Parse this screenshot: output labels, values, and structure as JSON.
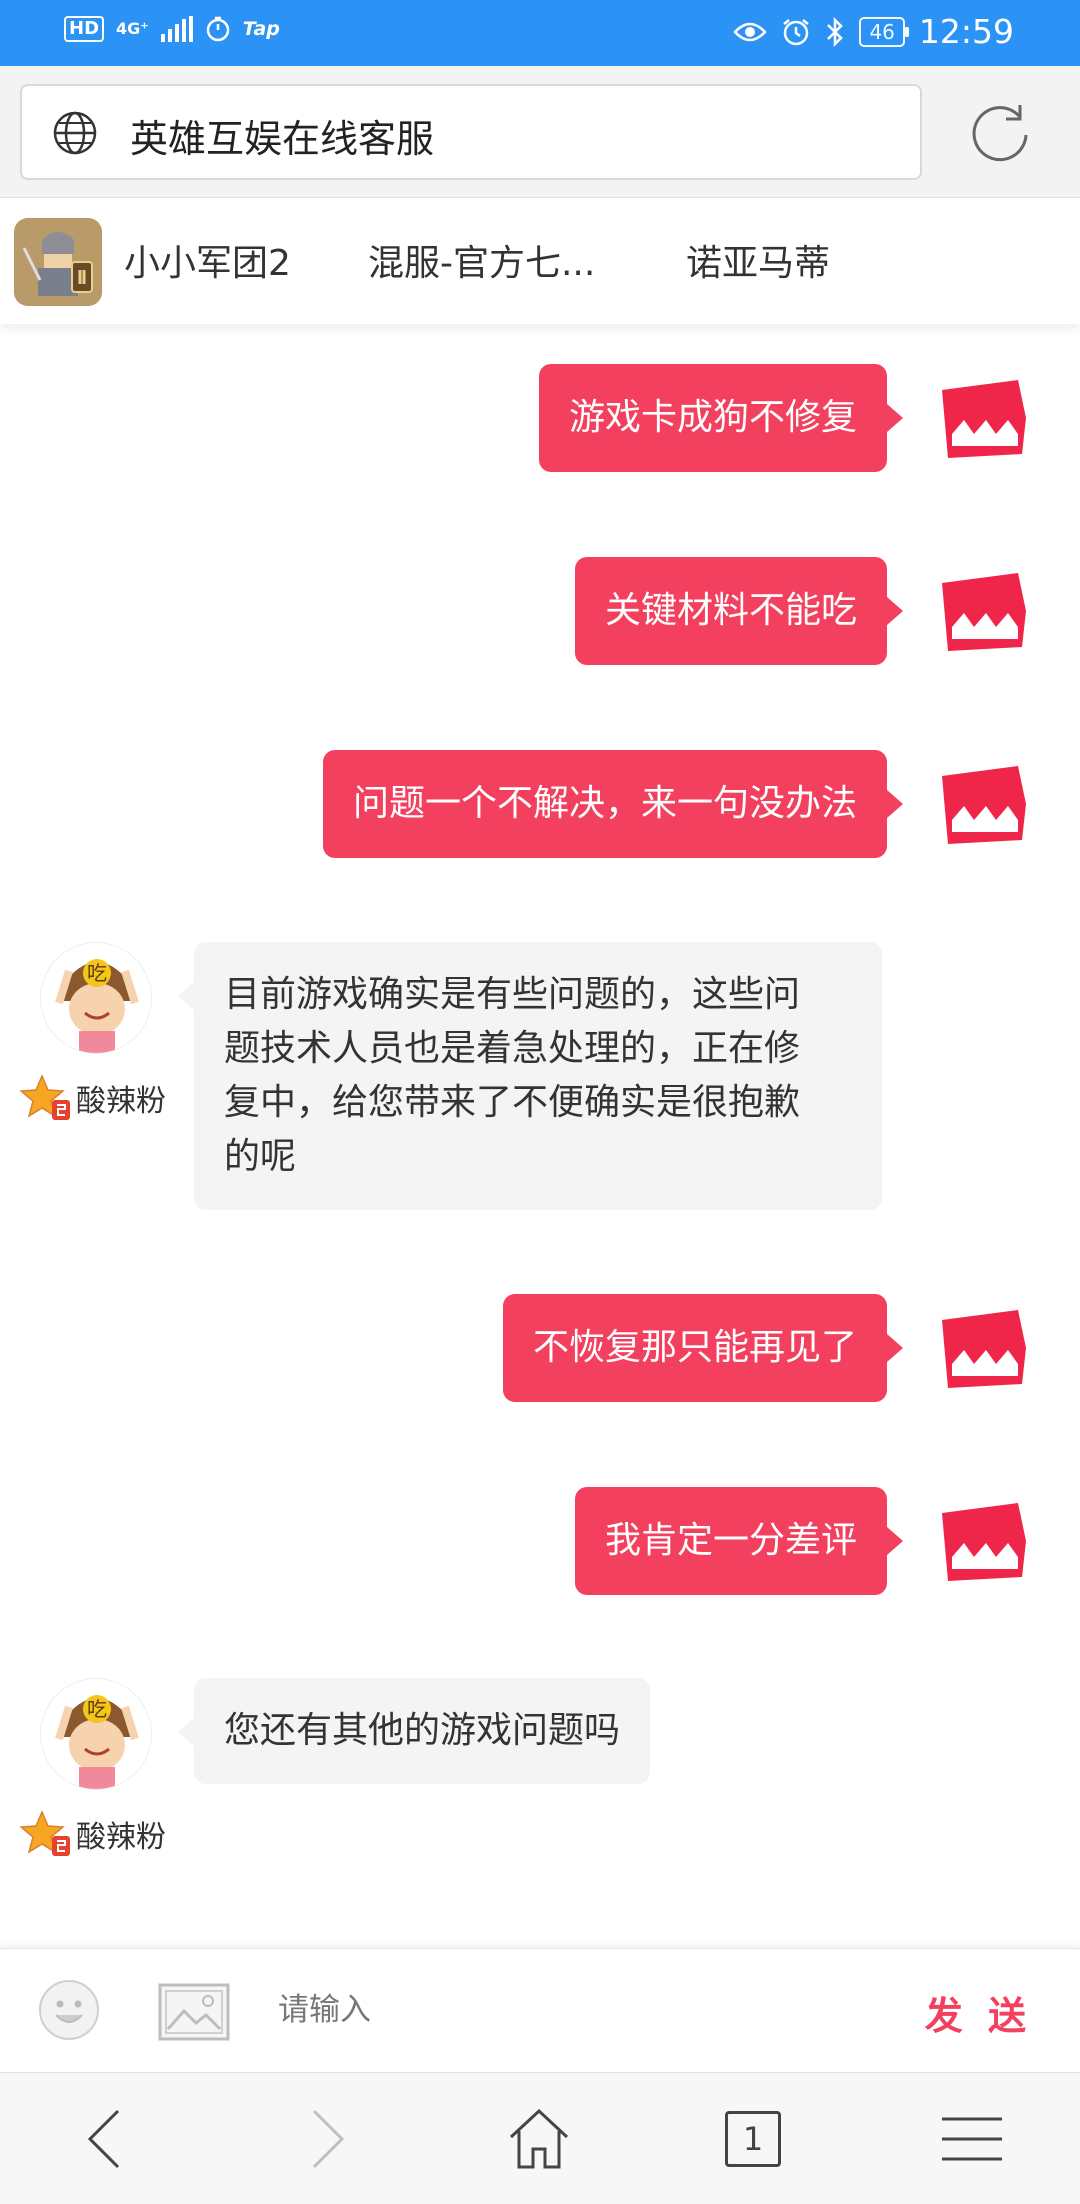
{
  "status_bar": {
    "hd": "HD",
    "network": "4G⁺",
    "app_label": "Tap",
    "battery": "46",
    "time": "12:59",
    "icons": [
      "hd-icon",
      "signal-icon",
      "timer-icon",
      "eye-icon",
      "alarm-icon",
      "bluetooth-icon",
      "battery-icon"
    ]
  },
  "url_bar": {
    "title": "英雄互娱在线客服"
  },
  "tabs": [
    {
      "label": "小小军团2"
    },
    {
      "label": "混服-官方七..."
    },
    {
      "label": "诺亚马蒂"
    }
  ],
  "agent": {
    "name": "酸辣粉",
    "avatar_text": "吃"
  },
  "messages": [
    {
      "side": "out",
      "text": "游戏卡成狗不修复"
    },
    {
      "side": "out",
      "text": "关键材料不能吃"
    },
    {
      "side": "out",
      "text": "问题一个不解决，来一句没办法"
    },
    {
      "side": "in",
      "lines": [
        "目前游戏确实是有些问题的，这些问",
        "题技术人员也是着急处理的，正在修",
        "复中，给您带来了不便确实是很抱歉",
        "的呢"
      ]
    },
    {
      "side": "out",
      "text": "不恢复那只能再见了"
    },
    {
      "side": "out",
      "text": "我肯定一分差评"
    },
    {
      "side": "in",
      "lines": [
        "您还有其他的游戏问题吗"
      ]
    }
  ],
  "input_bar": {
    "placeholder": "请输入",
    "send_label": "发 送"
  },
  "nav": {
    "tab_count": "1"
  },
  "colors": {
    "status_bar": "#2b93f5",
    "accent": "#f2405e",
    "incoming_bubble": "#f4f4f4"
  }
}
